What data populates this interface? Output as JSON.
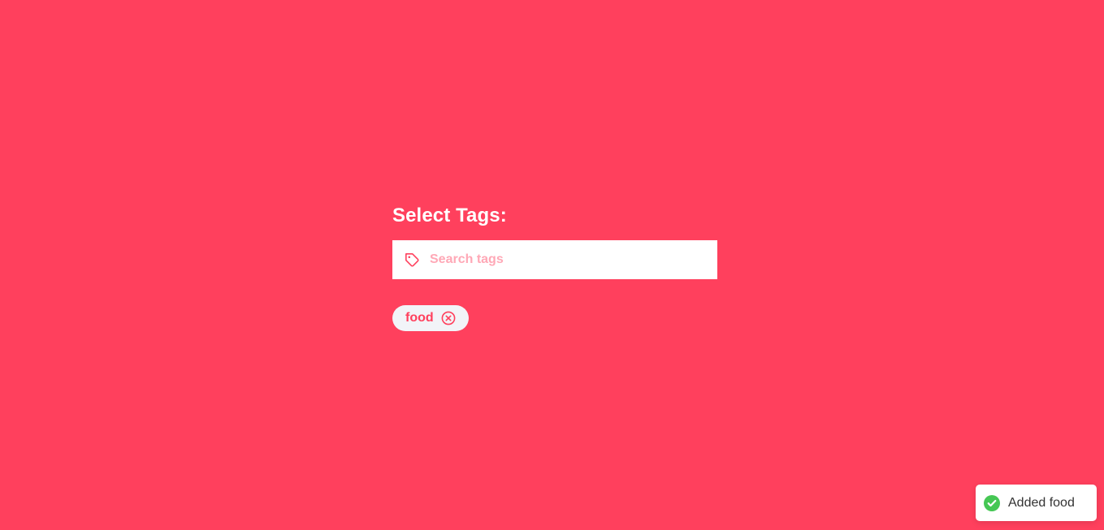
{
  "page": {
    "background_color": "#ff405d"
  },
  "tag_selector": {
    "title": "Select Tags:",
    "search": {
      "placeholder": "Search tags",
      "value": "",
      "icon": "tag-icon"
    },
    "selected_tags": [
      {
        "label": "food",
        "remove_icon": "close-circle-icon"
      }
    ]
  },
  "toast": {
    "message": "Added food",
    "icon": "check-circle-icon",
    "icon_color": "#45c754"
  },
  "colors": {
    "accent": "#ff405d",
    "chip_background": "#f2f4f8",
    "placeholder": "#ffa8b6",
    "success": "#45c754"
  }
}
